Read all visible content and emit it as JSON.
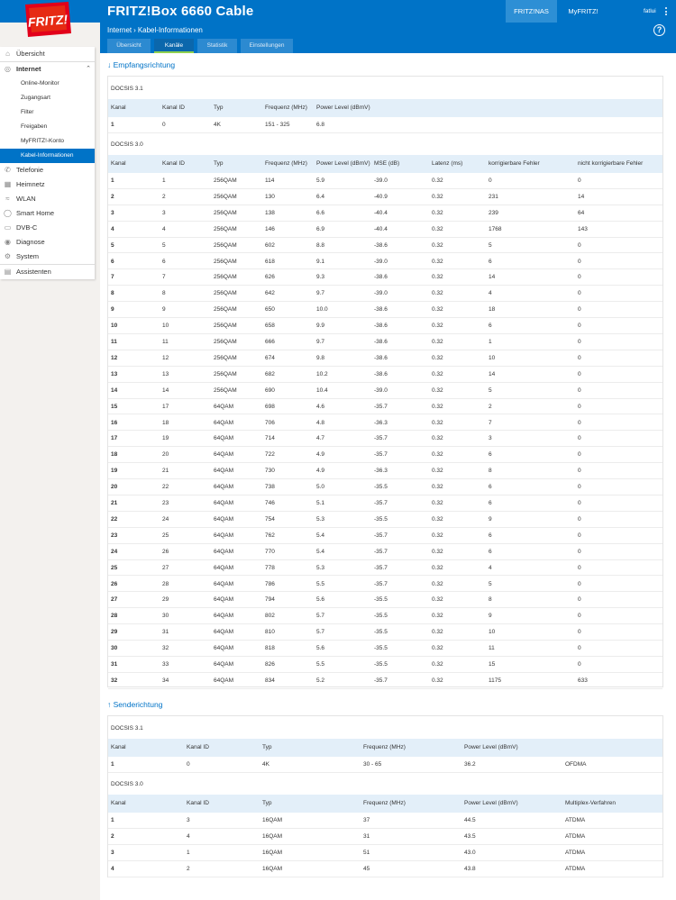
{
  "header": {
    "title": "FRITZ!Box 6660 Cable",
    "tab_nas": "FRITZ!NAS",
    "tab_myfritz": "MyFRITZ!",
    "user": "fatlui",
    "logo_text": "FRITZ!"
  },
  "breadcrumb": {
    "part1": "Internet",
    "part2": "Kabel-Informationen"
  },
  "help": "?",
  "tabs": [
    "Übersicht",
    "Kanäle",
    "Statistik",
    "Einstellungen"
  ],
  "sidebar": {
    "items": [
      {
        "label": "Übersicht",
        "icon": "home-icon"
      },
      {
        "label": "Internet",
        "icon": "globe-icon"
      },
      {
        "label": "Online-Monitor"
      },
      {
        "label": "Zugangsart"
      },
      {
        "label": "Filter"
      },
      {
        "label": "Freigaben"
      },
      {
        "label": "MyFRITZ!-Konto"
      },
      {
        "label": "Kabel-Informationen"
      },
      {
        "label": "Telefonie",
        "icon": "phone-icon"
      },
      {
        "label": "Heimnetz",
        "icon": "network-icon"
      },
      {
        "label": "WLAN",
        "icon": "wifi-icon"
      },
      {
        "label": "Smart Home",
        "icon": "smart-home-icon"
      },
      {
        "label": "DVB-C",
        "icon": "tv-icon"
      },
      {
        "label": "Diagnose",
        "icon": "diagnose-icon"
      },
      {
        "label": "System",
        "icon": "system-icon"
      },
      {
        "label": "Assistenten",
        "icon": "assistant-icon"
      }
    ]
  },
  "down": {
    "heading": "Empfangsrichtung",
    "docsis31": {
      "label": "DOCSIS 3.1",
      "headers": [
        "Kanal",
        "Kanal ID",
        "Typ",
        "Frequenz (MHz)",
        "Power Level (dBmV)"
      ],
      "rows": [
        [
          "1",
          "0",
          "4K",
          "151 - 325",
          "6.8"
        ]
      ]
    },
    "docsis30": {
      "label": "DOCSIS 3.0",
      "headers": [
        "Kanal",
        "Kanal ID",
        "Typ",
        "Frequenz (MHz)",
        "Power Level (dBmV)",
        "MSE (dB)",
        "Latenz (ms)",
        "korrigierbare Fehler",
        "nicht korrigierbare Fehler"
      ],
      "rows": [
        [
          "1",
          "1",
          "256QAM",
          "114",
          "5.9",
          "-39.0",
          "0.32",
          "0",
          "0"
        ],
        [
          "2",
          "2",
          "256QAM",
          "130",
          "6.4",
          "-40.9",
          "0.32",
          "231",
          "14"
        ],
        [
          "3",
          "3",
          "256QAM",
          "138",
          "6.6",
          "-40.4",
          "0.32",
          "239",
          "64"
        ],
        [
          "4",
          "4",
          "256QAM",
          "146",
          "6.9",
          "-40.4",
          "0.32",
          "1768",
          "143"
        ],
        [
          "5",
          "5",
          "256QAM",
          "602",
          "8.8",
          "-38.6",
          "0.32",
          "5",
          "0"
        ],
        [
          "6",
          "6",
          "256QAM",
          "618",
          "9.1",
          "-39.0",
          "0.32",
          "6",
          "0"
        ],
        [
          "7",
          "7",
          "256QAM",
          "626",
          "9.3",
          "-38.6",
          "0.32",
          "14",
          "0"
        ],
        [
          "8",
          "8",
          "256QAM",
          "642",
          "9.7",
          "-39.0",
          "0.32",
          "4",
          "0"
        ],
        [
          "9",
          "9",
          "256QAM",
          "650",
          "10.0",
          "-38.6",
          "0.32",
          "18",
          "0"
        ],
        [
          "10",
          "10",
          "256QAM",
          "658",
          "9.9",
          "-38.6",
          "0.32",
          "6",
          "0"
        ],
        [
          "11",
          "11",
          "256QAM",
          "666",
          "9.7",
          "-38.6",
          "0.32",
          "1",
          "0"
        ],
        [
          "12",
          "12",
          "256QAM",
          "674",
          "9.8",
          "-38.6",
          "0.32",
          "10",
          "0"
        ],
        [
          "13",
          "13",
          "256QAM",
          "682",
          "10.2",
          "-38.6",
          "0.32",
          "14",
          "0"
        ],
        [
          "14",
          "14",
          "256QAM",
          "690",
          "10.4",
          "-39.0",
          "0.32",
          "5",
          "0"
        ],
        [
          "15",
          "17",
          "64QAM",
          "698",
          "4.6",
          "-35.7",
          "0.32",
          "2",
          "0"
        ],
        [
          "16",
          "18",
          "64QAM",
          "706",
          "4.8",
          "-36.3",
          "0.32",
          "7",
          "0"
        ],
        [
          "17",
          "19",
          "64QAM",
          "714",
          "4.7",
          "-35.7",
          "0.32",
          "3",
          "0"
        ],
        [
          "18",
          "20",
          "64QAM",
          "722",
          "4.9",
          "-35.7",
          "0.32",
          "6",
          "0"
        ],
        [
          "19",
          "21",
          "64QAM",
          "730",
          "4.9",
          "-36.3",
          "0.32",
          "8",
          "0"
        ],
        [
          "20",
          "22",
          "64QAM",
          "738",
          "5.0",
          "-35.5",
          "0.32",
          "6",
          "0"
        ],
        [
          "21",
          "23",
          "64QAM",
          "746",
          "5.1",
          "-35.7",
          "0.32",
          "6",
          "0"
        ],
        [
          "22",
          "24",
          "64QAM",
          "754",
          "5.3",
          "-35.5",
          "0.32",
          "9",
          "0"
        ],
        [
          "23",
          "25",
          "64QAM",
          "762",
          "5.4",
          "-35.7",
          "0.32",
          "6",
          "0"
        ],
        [
          "24",
          "26",
          "64QAM",
          "770",
          "5.4",
          "-35.7",
          "0.32",
          "6",
          "0"
        ],
        [
          "25",
          "27",
          "64QAM",
          "778",
          "5.3",
          "-35.7",
          "0.32",
          "4",
          "0"
        ],
        [
          "26",
          "28",
          "64QAM",
          "786",
          "5.5",
          "-35.7",
          "0.32",
          "5",
          "0"
        ],
        [
          "27",
          "29",
          "64QAM",
          "794",
          "5.6",
          "-35.5",
          "0.32",
          "8",
          "0"
        ],
        [
          "28",
          "30",
          "64QAM",
          "802",
          "5.7",
          "-35.5",
          "0.32",
          "9",
          "0"
        ],
        [
          "29",
          "31",
          "64QAM",
          "810",
          "5.7",
          "-35.5",
          "0.32",
          "10",
          "0"
        ],
        [
          "30",
          "32",
          "64QAM",
          "818",
          "5.6",
          "-35.5",
          "0.32",
          "11",
          "0"
        ],
        [
          "31",
          "33",
          "64QAM",
          "826",
          "5.5",
          "-35.5",
          "0.32",
          "15",
          "0"
        ],
        [
          "32",
          "34",
          "64QAM",
          "834",
          "5.2",
          "-35.7",
          "0.32",
          "1175",
          "633"
        ]
      ]
    }
  },
  "up": {
    "heading": "Senderichtung",
    "docsis31": {
      "label": "DOCSIS 3.1",
      "headers": [
        "Kanal",
        "Kanal ID",
        "Typ",
        "Frequenz (MHz)",
        "Power Level (dBmV)",
        ""
      ],
      "rows": [
        [
          "1",
          "0",
          "4K",
          "30 - 65",
          "36.2",
          "OFDMA"
        ]
      ]
    },
    "docsis30": {
      "label": "DOCSIS 3.0",
      "headers": [
        "Kanal",
        "Kanal ID",
        "Typ",
        "Frequenz (MHz)",
        "Power Level (dBmV)",
        "Multiplex-Verfahren"
      ],
      "rows": [
        [
          "1",
          "3",
          "16QAM",
          "37",
          "44.5",
          "ATDMA"
        ],
        [
          "2",
          "4",
          "16QAM",
          "31",
          "43.5",
          "ATDMA"
        ],
        [
          "3",
          "1",
          "16QAM",
          "51",
          "43.0",
          "ATDMA"
        ],
        [
          "4",
          "2",
          "16QAM",
          "45",
          "43.8",
          "ATDMA"
        ]
      ]
    }
  },
  "colors": {
    "accent": "#0073c7",
    "header_row": "#e3eff9",
    "active_tab_underline": "#8fd14f",
    "logo_red": "#e2001a"
  }
}
